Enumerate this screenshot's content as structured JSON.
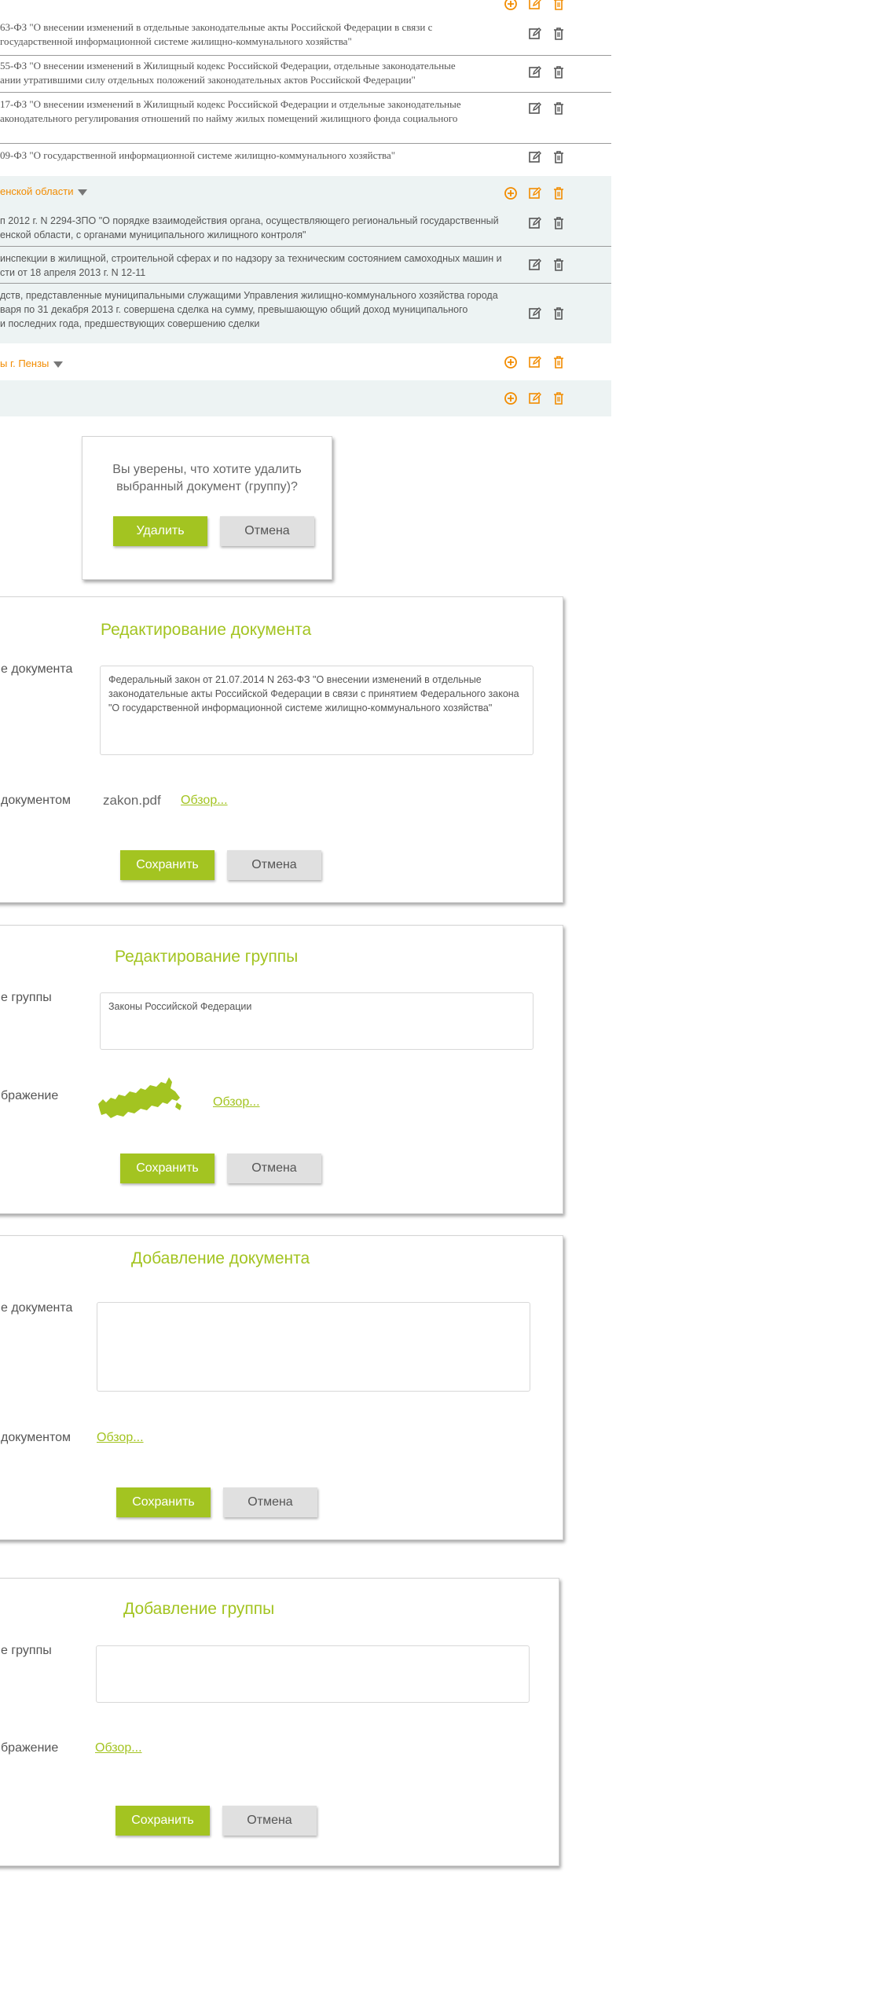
{
  "colors": {
    "accent_green": "#a3c421",
    "accent_orange": "#f28c00",
    "row_shade": "#edf3f3",
    "icon_dark": "#555555"
  },
  "list": {
    "rows": [
      {
        "text": "63-ФЗ \"О внесении изменений в отдельные законодательные акты Российской Федерации в связи с\nгосударственной информационной системе жилищно-коммунального хозяйства\""
      },
      {
        "text": "55-ФЗ \"О внесении изменений в Жилищный кодекс Российской Федерации, отдельные законодательные\nании утратившими силу отдельных положений законодательных актов Российской Федерации\""
      },
      {
        "text": "17-ФЗ \"О внесении изменений в Жилищный кодекс Российской Федерации и отдельные законодательные\nаконодательного регулирования отношений по найму жилых помещений жилищного фонда социального"
      },
      {
        "text": "09-ФЗ \"О государственной информационной системе жилищно-коммунального хозяйства\""
      }
    ],
    "group_region": {
      "title": "енской области",
      "rows": [
        {
          "text": "п 2012 г. N 2294-ЗПО \"О порядке взаимодействия органа, осуществляющего региональный государственный\nенской области, с органами муниципального жилищного контроля\""
        },
        {
          "text": "инспекции в жилищной, строительной сферах и по надзору за техническим состоянием самоходных машин и\nсти от 18 апреля 2013 г. N 12-11"
        },
        {
          "text": "дств, представленные муниципальными служащими Управления жилищно-коммунального хозяйства города\nваря по 31 декабря 2013 г. совершена сделка на сумму, превышающую общий доход муниципального\nи последних года, предшествующих совершению сделки"
        }
      ]
    },
    "group_city": {
      "title": "ы г. Пензы"
    },
    "icons": {
      "add": "plus-circle-icon",
      "edit": "edit-icon",
      "delete": "trash-icon"
    }
  },
  "confirm_dialog": {
    "message_line1": "Вы уверены, что хотите удалить",
    "message_line2": "выбранный документ (группу)?",
    "delete_label": "Удалить",
    "cancel_label": "Отмена"
  },
  "edit_document": {
    "title": "Редактирование документа",
    "name_label": "е документа",
    "name_value": "Федеральный закон от 21.07.2014 N 263-ФЗ \"О внесении изменений в отдельные законодательные акты Российской Федерации в связи с принятием Федерального закона \"О государственной информационной системе жилищно-коммунального хозяйства\"",
    "file_label": "документом",
    "file_name": "zakon.pdf",
    "browse_label": "Обзор...",
    "save_label": "Сохранить",
    "cancel_label": "Отмена"
  },
  "edit_group": {
    "title": "Редактирование группы",
    "name_label": "е группы",
    "name_value": "Законы Российской Федерации",
    "image_label": "бражение",
    "browse_label": "Обзор...",
    "save_label": "Сохранить",
    "cancel_label": "Отмена"
  },
  "add_document": {
    "title": "Добавление документа",
    "name_label": "е документа",
    "name_value": "",
    "file_label": "документом",
    "browse_label": "Обзор...",
    "save_label": "Сохранить",
    "cancel_label": "Отмена"
  },
  "add_group": {
    "title": "Добавление группы",
    "name_label": "е группы",
    "name_value": "",
    "image_label": "бражение",
    "browse_label": "Обзор...",
    "save_label": "Сохранить",
    "cancel_label": "Отмена"
  }
}
